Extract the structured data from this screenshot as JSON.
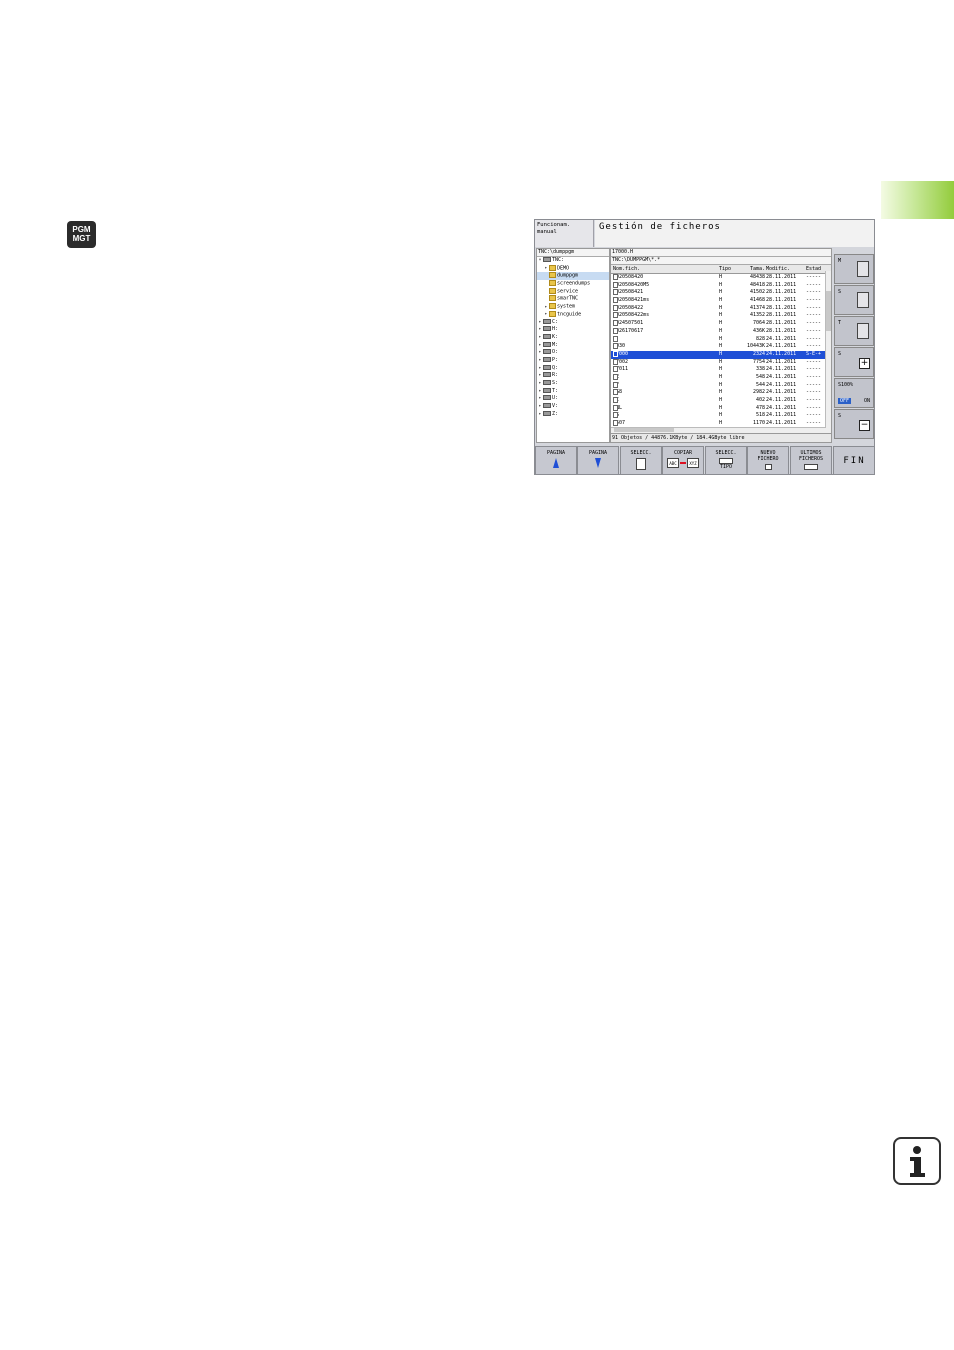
{
  "side_tab": {
    "color": "#93cc3c"
  },
  "key": {
    "line1": "PGM",
    "line2": "MGT"
  },
  "screen": {
    "mode": {
      "line1": "Funcionam.",
      "line2": "manual"
    },
    "title": "Gestión de ficheros",
    "tree": {
      "path": "TNC:\\dumppgm",
      "items": [
        {
          "label": "TNC:",
          "arrow": "▾",
          "kind": "drive"
        },
        {
          "label": "DEMO",
          "arrow": "▸",
          "kind": "folder"
        },
        {
          "label": "dumppgm",
          "arrow": "",
          "kind": "folder",
          "selected": true
        },
        {
          "label": "screendumps",
          "arrow": "",
          "kind": "folder"
        },
        {
          "label": "service",
          "arrow": "",
          "kind": "folder"
        },
        {
          "label": "smarTNC",
          "arrow": "",
          "kind": "folder"
        },
        {
          "label": "system",
          "arrow": "▸",
          "kind": "folder"
        },
        {
          "label": "tncguide",
          "arrow": "▸",
          "kind": "folder"
        },
        {
          "label": "C:",
          "arrow": "▸",
          "kind": "drive"
        },
        {
          "label": "H:",
          "arrow": "▸",
          "kind": "drive"
        },
        {
          "label": "K:",
          "arrow": "▸",
          "kind": "drive"
        },
        {
          "label": "M:",
          "arrow": "▸",
          "kind": "drive"
        },
        {
          "label": "O:",
          "arrow": "▸",
          "kind": "drive"
        },
        {
          "label": "P:",
          "arrow": "▸",
          "kind": "drive"
        },
        {
          "label": "Q:",
          "arrow": "▸",
          "kind": "drive"
        },
        {
          "label": "R:",
          "arrow": "▸",
          "kind": "drive"
        },
        {
          "label": "S:",
          "arrow": "▸",
          "kind": "drive"
        },
        {
          "label": "T:",
          "arrow": "▸",
          "kind": "drive"
        },
        {
          "label": "U:",
          "arrow": "▸",
          "kind": "drive"
        },
        {
          "label": "V:",
          "arrow": "▸",
          "kind": "drive"
        },
        {
          "label": "Z:",
          "arrow": "▸",
          "kind": "drive"
        }
      ]
    },
    "files": {
      "current_file": "17000.H",
      "path": "TNC:\\DUMPPGM\\*.*",
      "headers": {
        "name": "Nom.fich.",
        "type": "Tipo",
        "size": "Tama.",
        "date": "Modific.",
        "status": "Estad"
      },
      "rows": [
        {
          "name": "0020508420",
          "type": "H",
          "size": "48438",
          "date": "28.11.2011",
          "status": "-----"
        },
        {
          "name": "0020508420M5",
          "type": "H",
          "size": "48418",
          "date": "28.11.2011",
          "status": "-----"
        },
        {
          "name": "0020508421",
          "type": "H",
          "size": "41502",
          "date": "28.11.2011",
          "status": "-----"
        },
        {
          "name": "0020508421ms",
          "type": "H",
          "size": "41468",
          "date": "28.11.2011",
          "status": "-----"
        },
        {
          "name": "0020508422",
          "type": "H",
          "size": "41374",
          "date": "28.11.2011",
          "status": "-----"
        },
        {
          "name": "0020508422ms",
          "type": "H",
          "size": "41352",
          "date": "28.11.2011",
          "status": "-----"
        },
        {
          "name": "0024507501",
          "type": "H",
          "size": "7064",
          "date": "28.11.2011",
          "status": "-----"
        },
        {
          "name": "0026170617",
          "type": "H",
          "size": "436K",
          "date": "28.11.2011",
          "status": "-----"
        },
        {
          "name": "1",
          "type": "H",
          "size": "828",
          "date": "24.11.2011",
          "status": "-----"
        },
        {
          "name": "1030",
          "type": "H",
          "size": "10443K",
          "date": "24.11.2011",
          "status": "-----"
        },
        {
          "name": "17000",
          "type": "H",
          "size": "2324",
          "date": "24.11.2011",
          "status": "S-E-+",
          "selected": true
        },
        {
          "name": "17002",
          "type": "H",
          "size": "7754",
          "date": "24.11.2011",
          "status": "-----"
        },
        {
          "name": "17011",
          "type": "H",
          "size": "338",
          "date": "24.11.2011",
          "status": "-----"
        },
        {
          "name": "1E",
          "type": "H",
          "size": "548",
          "date": "24.11.2011",
          "status": "-----"
        },
        {
          "name": "1F",
          "type": "H",
          "size": "544",
          "date": "24.11.2011",
          "status": "-----"
        },
        {
          "name": "1G8",
          "type": "H",
          "size": "2982",
          "date": "24.11.2011",
          "status": "-----"
        },
        {
          "name": "1I",
          "type": "H",
          "size": "402",
          "date": "24.11.2011",
          "status": "-----"
        },
        {
          "name": "1NL",
          "type": "H",
          "size": "478",
          "date": "24.11.2011",
          "status": "-----"
        },
        {
          "name": "1S",
          "type": "H",
          "size": "518",
          "date": "24.11.2011",
          "status": "-----"
        },
        {
          "name": "3507",
          "type": "H",
          "size": "1170",
          "date": "24.11.2011",
          "status": "-----"
        },
        {
          "name": "3507I",
          "type": "H",
          "size": "588",
          "date": "24.11.2011",
          "status": "-----"
        }
      ],
      "status_bar": "91 Objetos / 44876.1KByte / 184.4GByte libre"
    },
    "side_buttons": [
      {
        "label": "M",
        "icon": "spindle-icon"
      },
      {
        "label": "S",
        "icon": "tool-icon"
      },
      {
        "label": "T",
        "icon": "tool-change-icon"
      },
      {
        "label": "S",
        "icon": "plus-icon",
        "glyph": "+"
      },
      {
        "label": "S100%",
        "off": "OFF",
        "on": "ON",
        "icon": "override-icon"
      },
      {
        "label": "S",
        "icon": "minus-icon",
        "glyph": "−"
      }
    ],
    "softkeys": [
      {
        "line1": "PAGINA",
        "line2": "",
        "icon": "arrow-up-icon"
      },
      {
        "line1": "PAGINA",
        "line2": "",
        "icon": "arrow-down-icon"
      },
      {
        "line1": "SELECC.",
        "line2": "",
        "icon": "document-icon"
      },
      {
        "line1": "COPIAR",
        "line2": "",
        "icon": "copy-icon",
        "from": "ABC",
        "to": "XYZ"
      },
      {
        "line1": "SELECC.",
        "line2": "TIPO",
        "icon": "file-type-icon"
      },
      {
        "line1": "NUEVO",
        "line2": "FICHERO",
        "icon": "new-file-icon"
      },
      {
        "line1": "ULTIMOS",
        "line2": "FICHEROS",
        "icon": "recent-files-icon"
      },
      {
        "line1": "FIN",
        "line2": "",
        "icon": ""
      }
    ]
  }
}
